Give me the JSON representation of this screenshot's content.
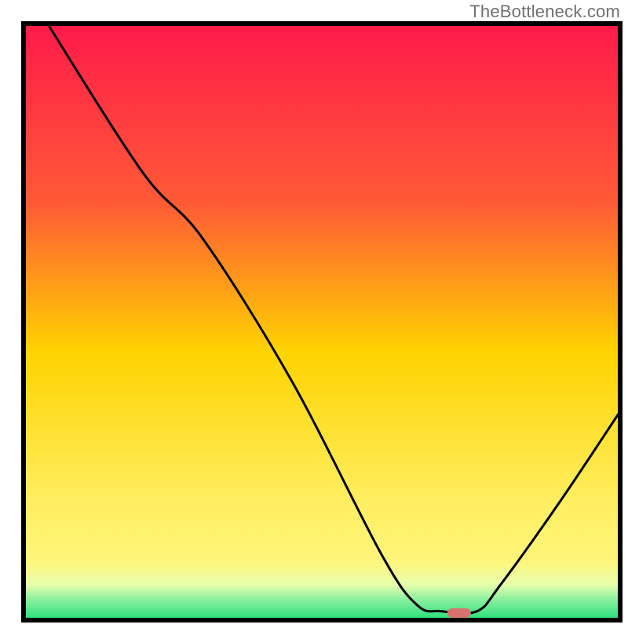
{
  "watermark": "TheBottleneck.com",
  "chart_data": {
    "type": "line",
    "title": "",
    "xlabel": "",
    "ylabel": "",
    "xlim": [
      0,
      1
    ],
    "ylim": [
      0,
      1
    ],
    "background_gradient": {
      "top": "#ff1a4a",
      "mid1": "#ff7a2e",
      "mid2": "#ffd300",
      "mid3": "#fff57a",
      "mid4": "#e8ffab",
      "bottom": "#22de7a"
    },
    "curve_points": [
      {
        "x": 0.04,
        "y": 1.0
      },
      {
        "x": 0.2,
        "y": 0.75
      },
      {
        "x": 0.3,
        "y": 0.64
      },
      {
        "x": 0.45,
        "y": 0.4
      },
      {
        "x": 0.6,
        "y": 0.11
      },
      {
        "x": 0.66,
        "y": 0.025
      },
      {
        "x": 0.7,
        "y": 0.015
      },
      {
        "x": 0.76,
        "y": 0.015
      },
      {
        "x": 0.8,
        "y": 0.06
      },
      {
        "x": 0.9,
        "y": 0.2
      },
      {
        "x": 1.0,
        "y": 0.35
      }
    ],
    "marker": {
      "x": 0.73,
      "y": 0.012,
      "color": "#d9726f"
    },
    "frame_color": "#000000"
  }
}
